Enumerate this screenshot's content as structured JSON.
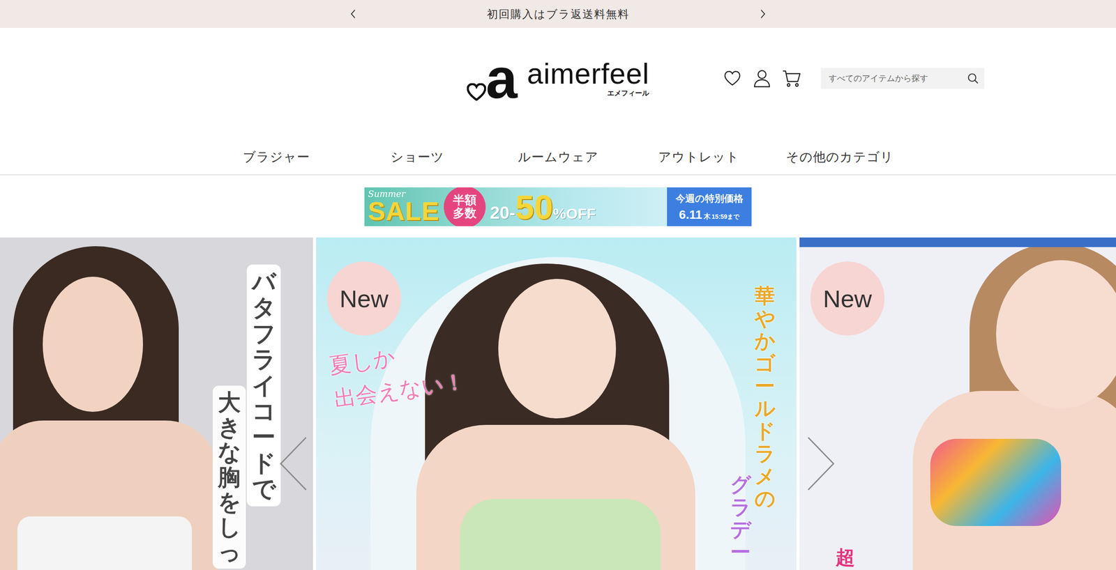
{
  "announcement": {
    "text": "初回購入はブラ返送料無料"
  },
  "logo": {
    "mark": "a",
    "name": "aimerfeel",
    "kana": "エメフィール"
  },
  "search": {
    "placeholder": "すべてのアイテムから探す"
  },
  "nav": [
    {
      "label": "ブラジャー"
    },
    {
      "label": "ショーツ"
    },
    {
      "label": "ルームウェア"
    },
    {
      "label": "アウトレット"
    },
    {
      "label": "その他のカテゴリ"
    }
  ],
  "sale_banner": {
    "script": "Summer",
    "title": "SALE",
    "badge_lines": [
      "半額",
      "多数"
    ],
    "from": "20-",
    "to": "50",
    "unit": "%OFF",
    "note": "今週の特別価格",
    "date": "6.11",
    "weekday": "木",
    "until": "15:59まで"
  },
  "slides": [
    {
      "badge": null,
      "captions": [
        {
          "text": "バタフライコードで",
          "kind": "vertical"
        },
        {
          "text": "大きな胸をしっ",
          "kind": "vertical"
        }
      ]
    },
    {
      "badge": "New",
      "captions": [
        {
          "text": "夏しか",
          "kind": "script"
        },
        {
          "text": "出会えない！",
          "kind": "script"
        },
        {
          "text": "華やかゴールドラメの",
          "kind": "vertical"
        },
        {
          "text": "グラデー",
          "kind": "vertical"
        }
      ]
    },
    {
      "badge": "New",
      "captions": [
        {
          "text": "超",
          "kind": "horizontal"
        }
      ]
    }
  ]
}
